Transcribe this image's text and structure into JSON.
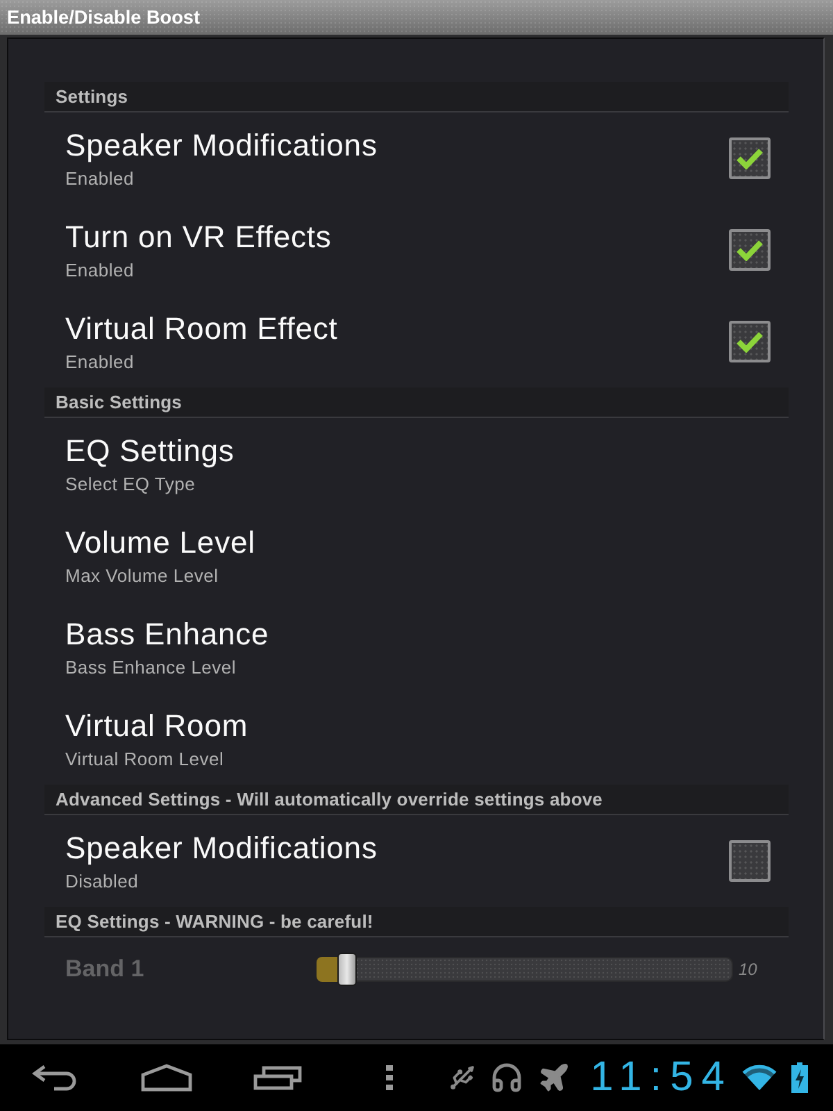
{
  "window": {
    "title": "Enable/Disable Boost"
  },
  "sections": [
    {
      "title": "Settings",
      "items": [
        {
          "kind": "checkbox",
          "title": "Speaker Modifications",
          "summary": "Enabled",
          "checked": true
        },
        {
          "kind": "checkbox",
          "title": "Turn on VR Effects",
          "summary": "Enabled",
          "checked": true
        },
        {
          "kind": "checkbox",
          "title": "Virtual Room Effect",
          "summary": "Enabled",
          "checked": true
        }
      ]
    },
    {
      "title": "Basic Settings",
      "items": [
        {
          "kind": "plain",
          "title": "EQ Settings",
          "summary": "Select EQ Type"
        },
        {
          "kind": "plain",
          "title": "Volume Level",
          "summary": "Max Volume Level"
        },
        {
          "kind": "plain",
          "title": "Bass Enhance",
          "summary": "Bass Enhance Level"
        },
        {
          "kind": "plain",
          "title": "Virtual Room",
          "summary": "Virtual Room Level"
        }
      ]
    },
    {
      "title": "Advanced Settings - Will automatically override settings above",
      "items": [
        {
          "kind": "checkbox",
          "title": "Speaker Modifications",
          "summary": "Disabled",
          "checked": false
        }
      ]
    },
    {
      "title": "EQ Settings - WARNING - be careful!",
      "items": [
        {
          "kind": "slider",
          "title": "Band 1",
          "disabled": true,
          "level": 0.07,
          "reading": "10"
        }
      ]
    }
  ],
  "nav_bar": {
    "clock": "11:54"
  }
}
